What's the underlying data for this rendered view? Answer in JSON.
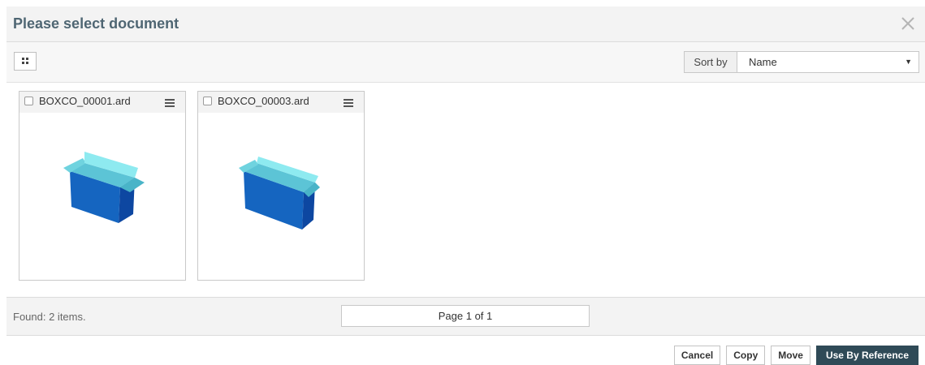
{
  "dialog": {
    "title": "Please select document"
  },
  "toolbar": {
    "sort_label": "Sort by",
    "sort_value": "Name"
  },
  "documents": [
    {
      "name": "BOXCO_00001.ard",
      "checked": false
    },
    {
      "name": "BOXCO_00003.ard",
      "checked": false
    }
  ],
  "footer": {
    "found_text": "Found: 2 items.",
    "page_text": "Page 1 of 1"
  },
  "actions": {
    "cancel": "Cancel",
    "copy": "Copy",
    "move": "Move",
    "use_by_reference": "Use By Reference"
  },
  "colors": {
    "title": "#4f6673",
    "primary_button": "#2f4a57",
    "box_front": "#1565c0",
    "box_lid": "#7fe0e8"
  }
}
